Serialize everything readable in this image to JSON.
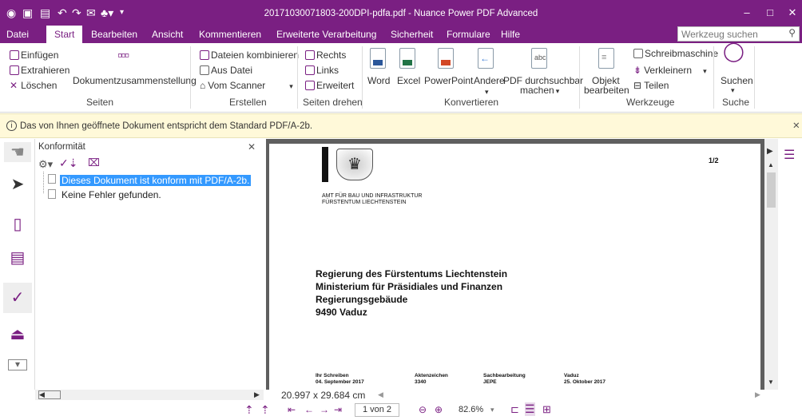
{
  "window": {
    "title": "20171030071803-200DPI-pdfa.pdf - Nuance Power PDF Advanced"
  },
  "menu": {
    "tabs": [
      "Datei",
      "Start",
      "Bearbeiten",
      "Ansicht",
      "Kommentieren",
      "Erweiterte Verarbeitung",
      "Sicherheit",
      "Formulare",
      "Hilfe"
    ],
    "active": "Start",
    "search_placeholder": "Werkzeug suchen"
  },
  "ribbon": {
    "seiten": {
      "einfuegen": "Einfügen",
      "extrahieren": "Extrahieren",
      "loeschen": "Löschen",
      "zusammenstellung": "Dokumentzusammenstellung",
      "group": "Seiten"
    },
    "erstellen": {
      "kombinieren": "Dateien kombinieren",
      "aus_datei": "Aus Datei",
      "vom_scanner": "Vom Scanner",
      "group": "Erstellen"
    },
    "drehen": {
      "rechts": "Rechts",
      "links": "Links",
      "erweitert": "Erweitert",
      "group": "Seiten drehen"
    },
    "konvertieren": {
      "word": "Word",
      "excel": "Excel",
      "powerpoint": "PowerPoint",
      "andere": "Andere",
      "durchsuchbar_1": "PDF durchsuchbar",
      "durchsuchbar_2": "machen",
      "group": "Konvertieren"
    },
    "werkzeuge": {
      "objekt_1": "Objekt",
      "objekt_2": "bearbeiten",
      "schreibmaschine": "Schreibmaschine",
      "verkleinern": "Verkleinern",
      "teilen": "Teilen",
      "group": "Werkzeuge"
    },
    "suche": {
      "suchen": "Suchen",
      "group": "Suche"
    }
  },
  "infobar": {
    "text": "Das von Ihnen geöffnete Dokument entspricht dem Standard PDF/A-2b."
  },
  "panel": {
    "title": "Konformität",
    "items": [
      "Dieses Dokument ist konform mit PDF/A-2b.",
      "Keine Fehler gefunden."
    ]
  },
  "document": {
    "page_number": "1/2",
    "office_1": "AMT FÜR BAU UND INFRASTRUKTUR",
    "office_2": "FÜRSTENTUM LIECHTENSTEIN",
    "address": [
      "Regierung des Fürstentums Liechtenstein",
      "Ministerium für Präsidiales und Finanzen",
      "Regierungsgebäude",
      "9490 Vaduz"
    ],
    "meta": [
      {
        "label": "Ihr Schreiben",
        "value": "04. September 2017"
      },
      {
        "label": "Aktenzeichen",
        "value": "3340"
      },
      {
        "label": "Sachbearbeitung",
        "value": "JEPE"
      },
      {
        "label": "Vaduz",
        "value": "25. Oktober 2017"
      }
    ]
  },
  "status": {
    "page_size": "20.997 x 29.684 cm",
    "page_field": "1 von 2",
    "zoom": "82.6%"
  },
  "colors": {
    "brand": "#7a1f82",
    "info": "#fff9d9",
    "selection": "#3399ff"
  }
}
